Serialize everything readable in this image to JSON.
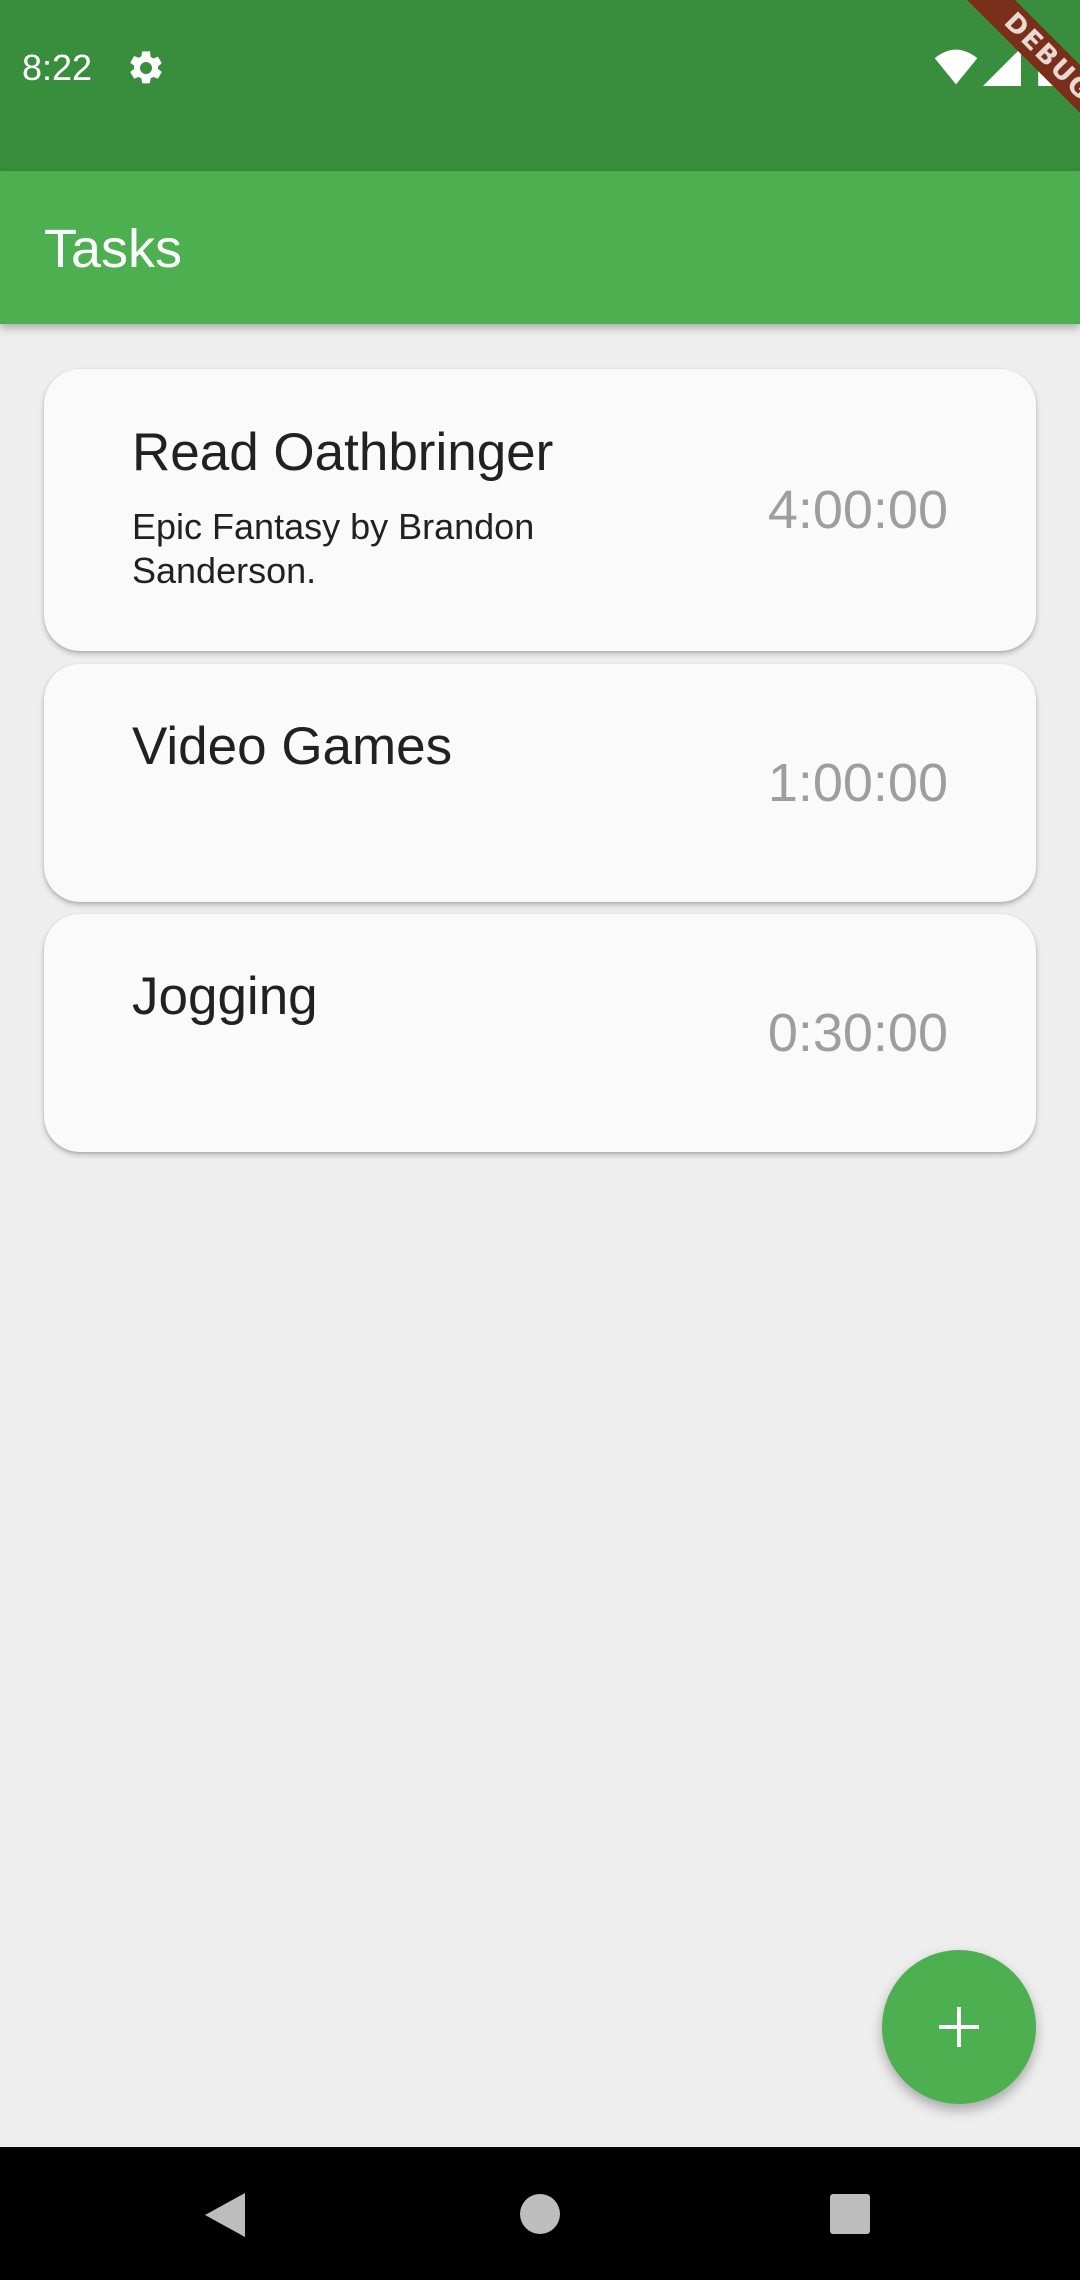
{
  "status_bar": {
    "time": "8:22",
    "icons": [
      "gear-icon",
      "wifi-icon",
      "signal-icon",
      "battery-icon"
    ],
    "debug_label": "DEBUG",
    "background_color": "#388e3c"
  },
  "app_bar": {
    "title": "Tasks",
    "background_color": "#4caf50"
  },
  "tasks": [
    {
      "title": "Read Oathbringer",
      "description": "Epic Fantasy by Brandon Sanderson.",
      "time": "4:00:00"
    },
    {
      "title": "Video Games",
      "description": "",
      "time": "1:00:00"
    },
    {
      "title": "Jogging",
      "description": "",
      "time": "0:30:00"
    }
  ],
  "fab": {
    "icon": "plus-icon",
    "color": "#4caf50"
  },
  "nav_bar": {
    "icons": [
      "back-icon",
      "home-icon",
      "recents-icon"
    ]
  }
}
